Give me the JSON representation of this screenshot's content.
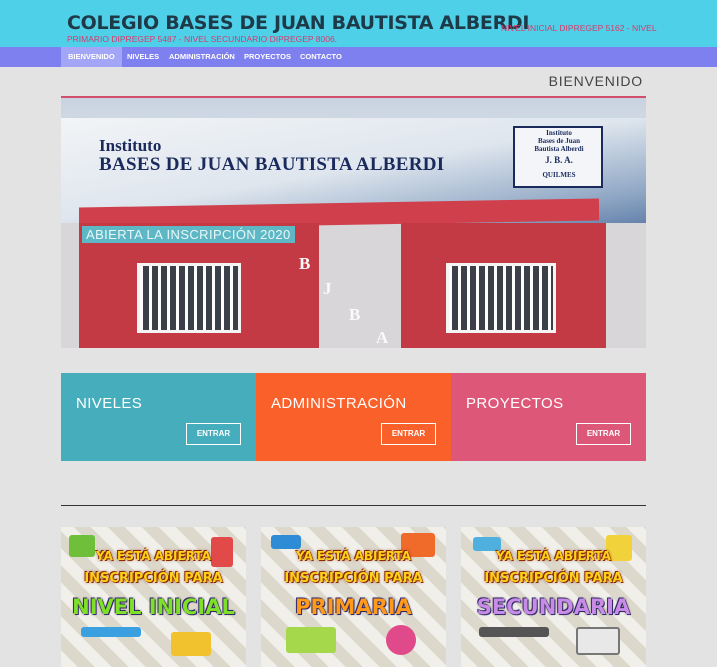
{
  "header": {
    "title": "COLEGIO BASES DE JUAN BAUTISTA ALBERDI",
    "subtitle_line1": "NIVEL INICIAL DIPREGEP 5162 - NIVEL",
    "subtitle_line2": "PRIMARIO DIPREGEP 5487 - NIVEL SECUNDARIO DIPREGEP 8006.",
    "colors": {
      "topbar": "#4fd0e9",
      "navbar": "#7e80f0",
      "subtitle": "#d83a6a"
    }
  },
  "nav": {
    "items": [
      {
        "label": "BIENVENIDO",
        "active": true
      },
      {
        "label": "NIVELES",
        "active": false
      },
      {
        "label": "ADMINISTRACIÓN",
        "active": false
      },
      {
        "label": "PROYECTOS",
        "active": false
      },
      {
        "label": "CONTACTO",
        "active": false
      }
    ]
  },
  "page": {
    "heading": "BIENVENIDO"
  },
  "hero": {
    "caption": "ABIERTA LA INSCRIPCIÓN 2020",
    "sign_line1": "Instituto",
    "sign_line2": "BASES DE JUAN BAUTISTA ALBERDI",
    "emblem_line1": "Instituto",
    "emblem_line2": "Bases de Juan",
    "emblem_line3": "Bautista Alberdi",
    "emblem_line4": "J. B. A.",
    "emblem_line5": "QUILMES",
    "letters": [
      "B",
      "J",
      "B",
      "A"
    ]
  },
  "cards": [
    {
      "title": "NIVELES",
      "button": "ENTRAR",
      "color": "#46adbd"
    },
    {
      "title": "ADMINISTRACIÓN",
      "button": "ENTRAR",
      "color": "#f9602a"
    },
    {
      "title": "PROYECTOS",
      "button": "ENTRAR",
      "color": "#dd5878"
    }
  ],
  "promos": [
    {
      "line1": "YA ESTÁ ABIERTA",
      "line2": "INSCRIPCIÓN PARA",
      "line3": "NIVEL INICIAL",
      "line3_color": "#7fe02a"
    },
    {
      "line1": "YA ESTÁ ABIERTA",
      "line2": "INSCRIPCIÓN PARA",
      "line3": "PRIMARIA",
      "line3_color": "#ff9a1a"
    },
    {
      "line1": "YA ESTÁ ABIERTA",
      "line2": "INSCRIPCIÓN PARA",
      "line3": "SECUNDARIA",
      "line3_color": "#c88be8"
    }
  ]
}
